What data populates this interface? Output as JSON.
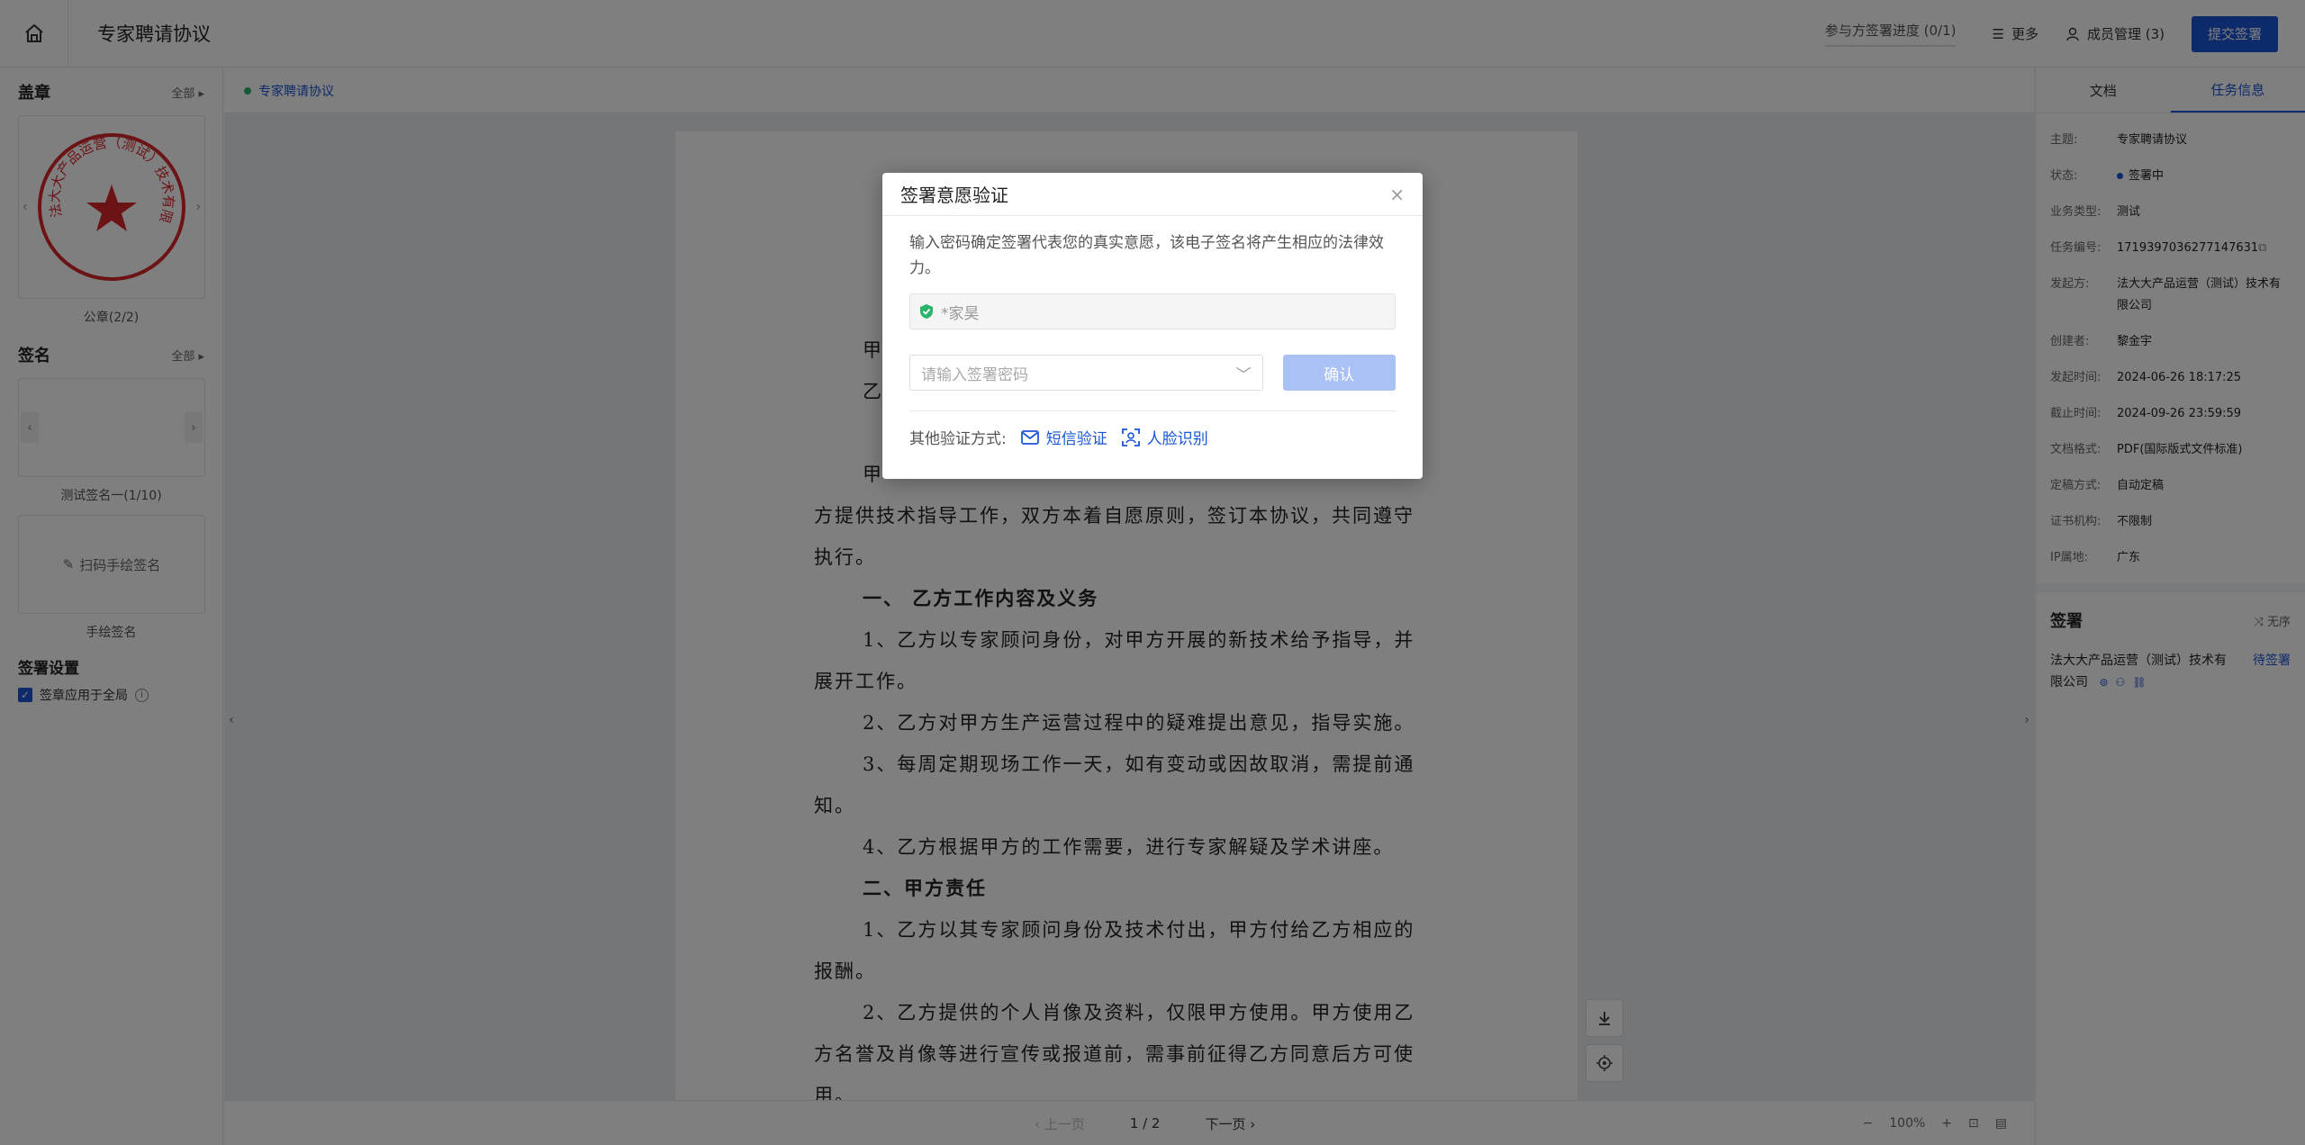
{
  "topbar": {
    "title": "专家聘请协议",
    "progress": "参与方签署进度 (0/1)",
    "more": "更多",
    "members": "成员管理 (3)",
    "submit": "提交签署"
  },
  "left": {
    "seal_title": "盖章",
    "seal_all": "全部",
    "seal_caption": "公章(2/2)",
    "seal_ring_text": "法大大产品运营（测试）技术有限公司",
    "sign_title": "签名",
    "sign_all": "全部",
    "sign_caption": "测试签名一(1/10)",
    "hand_label": "扫码手绘签名",
    "hand_caption": "手绘签名",
    "settings_title": "签署设置",
    "apply_global": "签章应用于全局"
  },
  "doc": {
    "tab": "专家聘请协议",
    "lines": [
      {
        "text": "甲",
        "cls": "indent"
      },
      {
        "text": "乙",
        "cls": "indent"
      },
      {
        "text": "",
        "cls": ""
      },
      {
        "text": "甲",
        "cls": "indent"
      },
      {
        "text": "方提供技术指导工作，双方本着自愿原则，签订本协议，共同遵守",
        "cls": ""
      },
      {
        "text": "执行。",
        "cls": ""
      },
      {
        "text": "一、  乙方工作内容及义务",
        "cls": "indent bold"
      },
      {
        "text": "1、乙方以专家顾问身份，对甲方开展的新技术给予指导，并",
        "cls": "indent"
      },
      {
        "text": "展开工作。",
        "cls": ""
      },
      {
        "text": "2、乙方对甲方生产运营过程中的疑难提出意见，指导实施。",
        "cls": "indent"
      },
      {
        "text": "3、每周定期现场工作一天，如有变动或因故取消，需提前通",
        "cls": "indent"
      },
      {
        "text": "知。",
        "cls": ""
      },
      {
        "text": "4、乙方根据甲方的工作需要，进行专家解疑及学术讲座。",
        "cls": "indent"
      },
      {
        "text": "二、甲方责任",
        "cls": "indent bold"
      },
      {
        "text": "1、乙方以其专家顾问身份及技术付出，甲方付给乙方相应的",
        "cls": "indent"
      },
      {
        "text": "报酬。",
        "cls": ""
      },
      {
        "text": "2、乙方提供的个人肖像及资料，仅限甲方使用。甲方使用乙",
        "cls": "indent"
      },
      {
        "text": "方名誉及肖像等进行宣传或报道前，需事前征得乙方同意后方可使",
        "cls": ""
      },
      {
        "text": "用。",
        "cls": ""
      }
    ]
  },
  "pager": {
    "prev": "上一页",
    "page": "1 / 2",
    "next": "下一页",
    "zoom": "100%"
  },
  "right": {
    "tab_doc": "文档",
    "tab_info": "任务信息",
    "info": [
      {
        "label": "主题:",
        "value": "专家聘请协议"
      },
      {
        "label": "状态:",
        "value": "签署中"
      },
      {
        "label": "业务类型:",
        "value": "测试"
      },
      {
        "label": "任务编号:",
        "value": "1719397036277147631"
      },
      {
        "label": "发起方:",
        "value": "法大大产品运营（测试）技术有限公司"
      },
      {
        "label": "创建者:",
        "value": "黎金宇"
      },
      {
        "label": "发起时间:",
        "value": "2024-06-26 18:17:25"
      },
      {
        "label": "截止时间:",
        "value": "2024-09-26 23:59:59"
      },
      {
        "label": "文档格式:",
        "value": "PDF(国际版式文件标准)"
      },
      {
        "label": "定稿方式:",
        "value": "自动定稿"
      },
      {
        "label": "证书机构:",
        "value": "不限制"
      },
      {
        "label": "IP属地:",
        "value": "广东"
      }
    ],
    "sign_title": "签署",
    "sign_order": "无序",
    "signer_name": "法大大产品运营（测试）技术有限公司",
    "signer_status": "待签署"
  },
  "modal": {
    "title": "签署意愿验证",
    "desc": "输入密码确定签署代表您的真实意愿，该电子签名将产生相应的法律效力。",
    "name": "*家昊",
    "pwd_placeholder": "请输入签署密码",
    "confirm": "确认",
    "alt_label": "其他验证方式:",
    "sms": "短信验证",
    "face": "人脸识别"
  }
}
